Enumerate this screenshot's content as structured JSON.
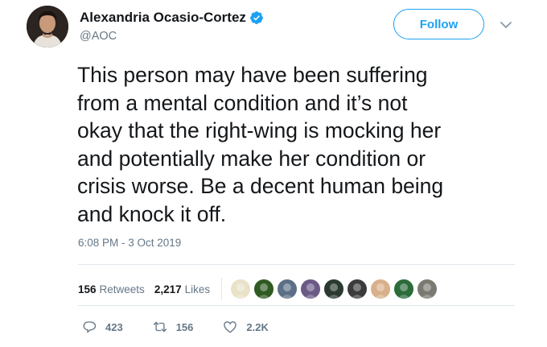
{
  "author": {
    "name": "Alexandria Ocasio-Cortez",
    "handle": "@AOC",
    "verified": true
  },
  "follow_button": {
    "label": "Follow"
  },
  "tweet": {
    "text": "This person may have been suffering\nfrom a mental condition and it’s not\nokay that the right-wing is mocking her\nand potentially make her condition or\ncrisis worse. Be a decent human being\nand knock it off.",
    "timestamp": "6:08 PM - 3 Oct 2019"
  },
  "stats": {
    "retweets_count": "156",
    "retweets_label": "Retweets",
    "likes_count": "2,217",
    "likes_label": "Likes"
  },
  "liker_avatars": [
    {
      "name": "bee-avatar",
      "color": "#e9e2c8"
    },
    {
      "name": "red-flower-avatar",
      "color": "#2f5a22"
    },
    {
      "name": "car-avatar",
      "color": "#5b6f86"
    },
    {
      "name": "purple-avatar",
      "color": "#6b5a86"
    },
    {
      "name": "dark-avatar",
      "color": "#2a3a30"
    },
    {
      "name": "woman-avatar",
      "color": "#3b3b3b"
    },
    {
      "name": "cartoon-avatar",
      "color": "#d9b08c"
    },
    {
      "name": "green-avatar",
      "color": "#2c6b3a"
    },
    {
      "name": "dog-avatar",
      "color": "#7a7a72"
    }
  ],
  "actions": {
    "replies": "423",
    "retweets": "156",
    "likes": "2.2K"
  },
  "colors": {
    "accent": "#1da1f2",
    "text": "#14171a",
    "muted": "#657786",
    "divider": "#e1e8ed"
  }
}
